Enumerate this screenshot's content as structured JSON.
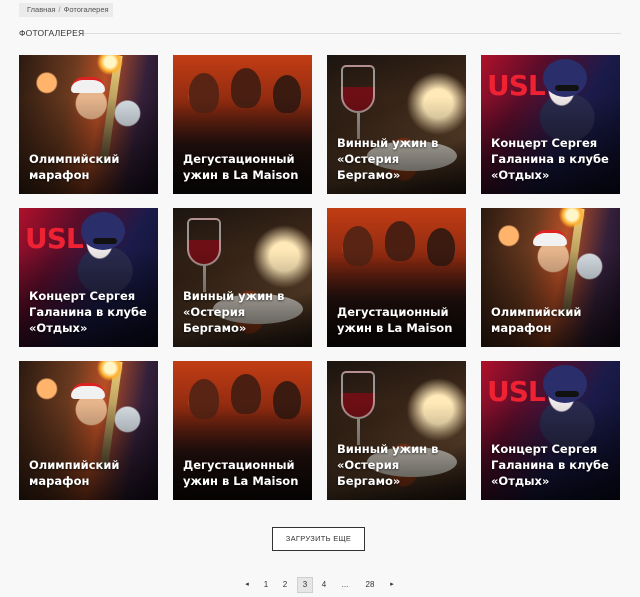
{
  "breadcrumb": {
    "home": "Главная",
    "separator": "/",
    "current": "Фотогалерея"
  },
  "section_title": "ФОТОГАЛЕРЕЯ",
  "gallery": [
    {
      "photo": "olympic",
      "caption": "Олимпийский марафон"
    },
    {
      "photo": "degustation",
      "caption": "Дегустационный ужин в La Maison"
    },
    {
      "photo": "wine",
      "caption": "Винный ужин в «Остерия Бергамо»"
    },
    {
      "photo": "concert",
      "caption": "Концерт Сергея Галанина в клубе «Отдых»"
    },
    {
      "photo": "concert",
      "caption": "Концерт Сергея Галанина в клубе «Отдых»"
    },
    {
      "photo": "wine",
      "caption": "Винный ужин в «Остерия Бергамо»"
    },
    {
      "photo": "degustation",
      "caption": "Дегустационный ужин в La Maison"
    },
    {
      "photo": "olympic",
      "caption": "Олимпийский марафон"
    },
    {
      "photo": "olympic",
      "caption": "Олимпийский марафон"
    },
    {
      "photo": "degustation",
      "caption": "Дегустационный ужин в La Maison"
    },
    {
      "photo": "wine",
      "caption": "Винный ужин в «Остерия Бергамо»"
    },
    {
      "photo": "concert",
      "caption": "Концерт Сергея Галанина в клубе «Отдых»"
    }
  ],
  "load_more_label": "ЗАГРУЗИТЬ ЕЩЕ",
  "pagination": {
    "prev_icon": "◂",
    "next_icon": "▸",
    "pages": [
      "1",
      "2",
      "3",
      "4",
      "...",
      "28"
    ],
    "current": "3"
  }
}
